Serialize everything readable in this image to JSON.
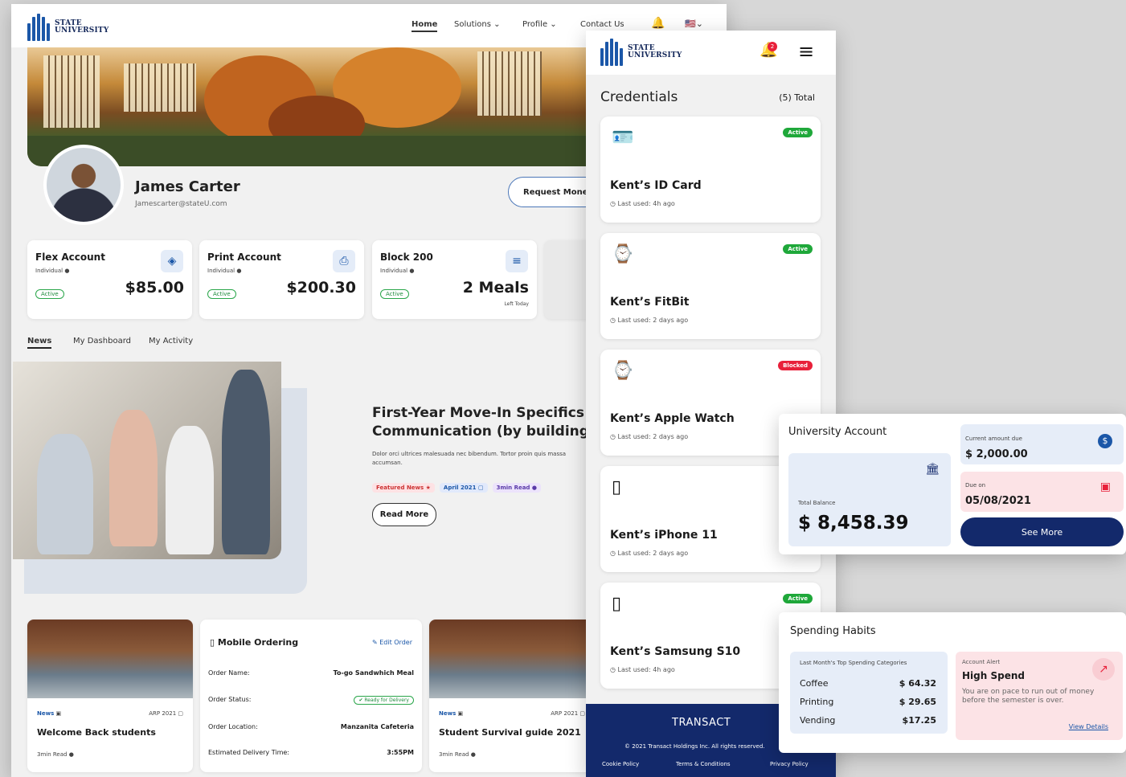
{
  "desktop": {
    "logo": {
      "line1": "STATE",
      "line2": "UNIVERSITY"
    },
    "nav": {
      "home": "Home",
      "solutions": "Solutions",
      "profile": "Profile",
      "contact": "Contact Us"
    },
    "profile": {
      "name": "James Carter",
      "email": "Jamescarter@stateU.com",
      "request_button": "Request Money"
    },
    "accounts": [
      {
        "title": "Flex Account",
        "sub": "Individual",
        "status": "Active",
        "amount": "$85.00",
        "icon": "shield-icon"
      },
      {
        "title": "Print Account",
        "sub": "Individual",
        "status": "Active",
        "amount": "$200.30",
        "icon": "printer-icon"
      },
      {
        "title": "Block 200",
        "sub": "Individual",
        "status": "Active",
        "amount": "2 Meals",
        "note": "Left Today",
        "icon": "meal-icon"
      }
    ],
    "tabs": [
      "News",
      "My Dashboard",
      "My Activity"
    ],
    "feature": {
      "title_line1": "First-Year Move-In Specifics",
      "title_line2": "Communication (by building)",
      "body_line1": "Dolor orci ultrices malesuada nec bibendum. Tortor proin quis massa",
      "body_line2": "accumsan.",
      "chips": [
        "Featured News",
        "April 2021",
        "3min Read"
      ],
      "read_more": "Read More"
    },
    "news_cards": [
      {
        "tag": "News",
        "date": "ARP 2021",
        "title": "Welcome Back students",
        "read": "3min Read"
      },
      {
        "tag": "News",
        "date": "ARP 2021",
        "title": "Student Survival guide 2021",
        "read": "3min Read"
      }
    ],
    "mobile_ordering": {
      "title": "Mobile Ordering",
      "edit": "Edit Order",
      "rows": [
        {
          "label": "Order Name:",
          "value": "To-go Sandwhich Meal"
        },
        {
          "label": "Order Status:",
          "value": "Ready for Delivery"
        },
        {
          "label": "Order Location:",
          "value": "Manzanita Cafeteria"
        },
        {
          "label": "Estimated Delivery Time:",
          "value": "3:55PM"
        }
      ]
    }
  },
  "mobile": {
    "notification_count": "2",
    "credentials_title": "Credentials",
    "total": "(5) Total",
    "credentials": [
      {
        "name": "Kent’s ID Card",
        "last_used": "Last used: 4h ago",
        "status": "Active",
        "icon": "id-card-icon"
      },
      {
        "name": "Kent’s FitBit",
        "last_used": "Last used: 2 days ago",
        "status": "Active",
        "icon": "fitbit-icon"
      },
      {
        "name": "Kent’s Apple Watch",
        "last_used": "Last used: 2 days ago",
        "status": "Blocked",
        "icon": "apple-watch-icon"
      },
      {
        "name": "Kent’s iPhone 11",
        "last_used": "Last used: 2 days ago",
        "status": "",
        "icon": "phone-icon"
      },
      {
        "name": "Kent’s Samsung S10",
        "last_used": "Last used: 4h ago",
        "status": "Active",
        "icon": "phone-icon"
      }
    ],
    "footer": {
      "brand": "TRANSACT",
      "copyright": "© 2021 Transact Holdings Inc. All rights reserved.",
      "links": [
        "Cookie Policy",
        "Terms & Conditions",
        "Privacy Policy"
      ]
    }
  },
  "university_account": {
    "title": "University Account",
    "total_label": "Total Balance",
    "total_value": "$ 8,458.39",
    "due_label": "Current amount due",
    "due_value": "$ 2,000.00",
    "due_on_label": "Due on",
    "due_on_value": "05/08/2021",
    "see_more": "See More"
  },
  "spending": {
    "title": "Spending Habits",
    "subtitle": "Last Month's Top Spending Categories",
    "categories": [
      {
        "name": "Coffee",
        "value": "$ 64.32"
      },
      {
        "name": "Printing",
        "value": "$ 29.65"
      },
      {
        "name": "Vending",
        "value": "$17.25"
      }
    ],
    "alert": {
      "label": "Account Alert",
      "title": "High Spend",
      "body": "You are on pace to run out of money before the semester is over.",
      "link": "View Details"
    }
  },
  "colors": {
    "navy": "#13296b",
    "active_green": "#1fa83a",
    "blocked_red": "#e8203a",
    "accent_blue": "#1b57a8"
  }
}
